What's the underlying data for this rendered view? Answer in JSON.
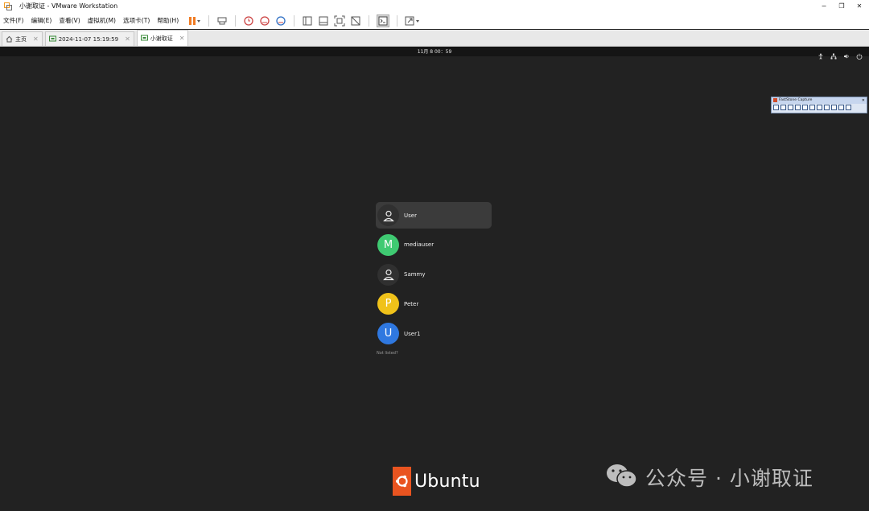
{
  "window": {
    "title": "小谢取证 - VMware Workstation",
    "controls": [
      "−",
      "❐",
      "✕"
    ]
  },
  "menubar": {
    "items": [
      "文件(F)",
      "编辑(E)",
      "查看(V)",
      "虚拟机(M)",
      "选项卡(T)",
      "帮助(H)"
    ]
  },
  "tabs": [
    {
      "label": "主页",
      "icon": "home-icon",
      "active": false
    },
    {
      "label": "2024-11-07 15:19:59",
      "icon": "vm-icon",
      "active": false
    },
    {
      "label": "小谢取证",
      "icon": "vm-icon",
      "active": true
    }
  ],
  "guest": {
    "clock": "11月 8  00：59",
    "users": [
      {
        "name": "User",
        "initial": "",
        "color": "#303030",
        "selected": true
      },
      {
        "name": "mediauser",
        "initial": "M",
        "color": "#3fca72",
        "selected": false
      },
      {
        "name": "Sammy",
        "initial": "",
        "color": "#303030",
        "selected": false
      },
      {
        "name": "Peter",
        "initial": "P",
        "color": "#f0c21a",
        "selected": false
      },
      {
        "name": "User1",
        "initial": "U",
        "color": "#2f78e0",
        "selected": false
      }
    ],
    "not_listed": "Not listed?",
    "logo_text": "Ubuntu"
  },
  "fastcapture": {
    "title": "FastStone Capture"
  },
  "watermark": {
    "text": "公众号 · 小谢取证"
  },
  "colors": {
    "ubuntu_orange": "#e95420",
    "pause_orange": "#f07b22"
  }
}
